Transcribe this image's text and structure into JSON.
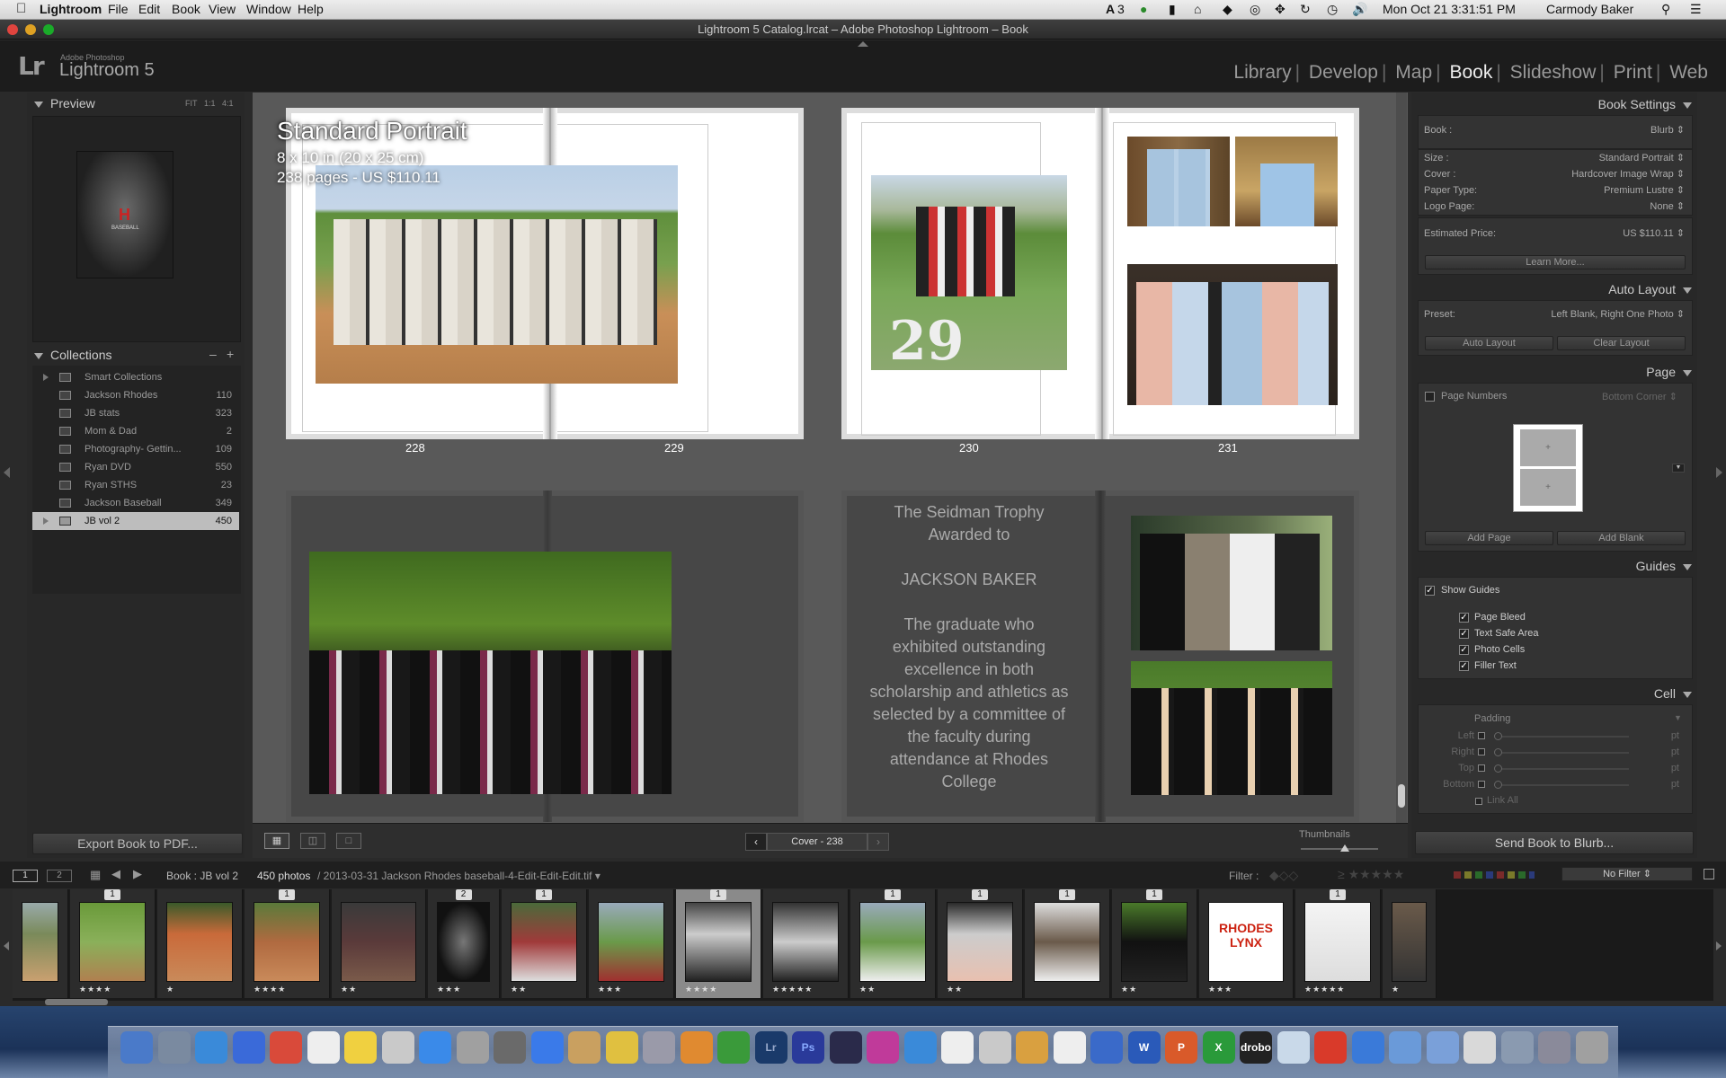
{
  "menubar": {
    "app": "Lightroom",
    "items": [
      "File",
      "Edit",
      "Book",
      "View",
      "Window",
      "Help"
    ],
    "status": [
      "3"
    ],
    "clock": "Mon Oct 21  3:31:51 PM",
    "user": "Carmody Baker"
  },
  "window": {
    "title": "Lightroom 5 Catalog.lrcat – Adobe Photoshop Lightroom – Book"
  },
  "identity": {
    "logo": "Lr",
    "sub1": "Adobe Photoshop",
    "sub2": "Lightroom 5"
  },
  "modules": [
    "Library",
    "Develop",
    "Map",
    "Book",
    "Slideshow",
    "Print",
    "Web"
  ],
  "active_module": "Book",
  "left": {
    "preview_title": "Preview",
    "zoom_opts": [
      "FIT",
      "1:1",
      "4:1"
    ],
    "collections_title": "Collections",
    "collections": [
      {
        "name": "Smart Collections",
        "count": ""
      },
      {
        "name": "Jackson Rhodes",
        "count": "110"
      },
      {
        "name": "JB stats",
        "count": "323"
      },
      {
        "name": "Mom & Dad",
        "count": "2"
      },
      {
        "name": "Photography- Gettin...",
        "count": "109"
      },
      {
        "name": "Ryan DVD",
        "count": "550"
      },
      {
        "name": "Ryan STHS",
        "count": "23"
      },
      {
        "name": "Jackson Baseball",
        "count": "349"
      },
      {
        "name": "JB vol 2",
        "count": "450"
      }
    ],
    "export_button": "Export Book to PDF..."
  },
  "right": {
    "book_settings_title": "Book Settings",
    "book_label": "Book :",
    "book_value": "Blurb",
    "size_label": "Size :",
    "size_value": "Standard Portrait",
    "cover_label": "Cover :",
    "cover_value": "Hardcover Image Wrap",
    "paper_label": "Paper Type:",
    "paper_value": "Premium Lustre",
    "logo_label": "Logo Page:",
    "logo_value": "None",
    "price_label": "Estimated Price:",
    "price_value": "US $110.11",
    "learn_more": "Learn More...",
    "auto_layout_title": "Auto Layout",
    "preset_label": "Preset:",
    "preset_value": "Left Blank, Right One Photo",
    "auto_layout_btn": "Auto Layout",
    "clear_layout_btn": "Clear Layout",
    "page_title": "Page",
    "page_numbers": "Page Numbers",
    "page_numbers_pos": "Bottom Corner",
    "add_page": "Add Page",
    "add_blank": "Add Blank",
    "guides_title": "Guides",
    "show_guides": "Show Guides",
    "guides": [
      "Page Bleed",
      "Text Safe Area",
      "Photo Cells",
      "Filler Text"
    ],
    "cell_title": "Cell",
    "padding": "Padding",
    "padding_rows": [
      "Left",
      "Right",
      "Top",
      "Bottom"
    ],
    "unit": "pt",
    "link_all": "Link All",
    "send_button": "Send Book to Blurb..."
  },
  "book": {
    "overlay_title": "Standard Portrait",
    "overlay_size": "8 x 10 in (20 x 25 cm)",
    "overlay_pages": "238 pages - US $110.11",
    "page_numbers": [
      "228",
      "229",
      "230",
      "231"
    ],
    "trophy_text": [
      "The Seidman Trophy",
      "Awarded to",
      "",
      "JACKSON BAKER",
      "",
      "The graduate who",
      "exhibited outstanding",
      "excellence in both",
      "scholarship and athletics as",
      "selected by a committee of",
      "the faculty during",
      "attendance at Rhodes",
      "College"
    ],
    "nav_label": "Cover - 238",
    "thumbnails_label": "Thumbnails"
  },
  "filmstrip": {
    "source": "Book : JB vol 2",
    "count": "450 photos",
    "file": "/ 2013-03-31 Jackson Rhodes baseball-4-Edit-Edit-Edit.tif",
    "filter_label": "Filter :",
    "filter_value": "No Filter",
    "view_nums": [
      "1",
      "2"
    ],
    "thumbs": [
      {
        "badge": "",
        "stars": ""
      },
      {
        "badge": "1",
        "stars": "★★★★"
      },
      {
        "badge": "",
        "stars": "★"
      },
      {
        "badge": "1",
        "stars": "★★★★"
      },
      {
        "badge": "",
        "stars": "★★"
      },
      {
        "badge": "2",
        "stars": "★★★"
      },
      {
        "badge": "1",
        "stars": "★★"
      },
      {
        "badge": "",
        "stars": "★★★"
      },
      {
        "badge": "1",
        "stars": "★★★★"
      },
      {
        "badge": "",
        "stars": "★★★★★"
      },
      {
        "badge": "1",
        "stars": "★★"
      },
      {
        "badge": "1",
        "stars": "★★"
      },
      {
        "badge": "1",
        "stars": ""
      },
      {
        "badge": "1",
        "stars": "★★"
      },
      {
        "badge": "",
        "stars": "★★★"
      },
      {
        "badge": "1",
        "stars": "★★★★★"
      },
      {
        "badge": "",
        "stars": "★"
      }
    ],
    "thumb_text_rhodes": "RHODES LYNX"
  },
  "dock": {
    "labels": [
      "Lr",
      "Ps",
      "W",
      "P",
      "X",
      "drobo"
    ]
  }
}
